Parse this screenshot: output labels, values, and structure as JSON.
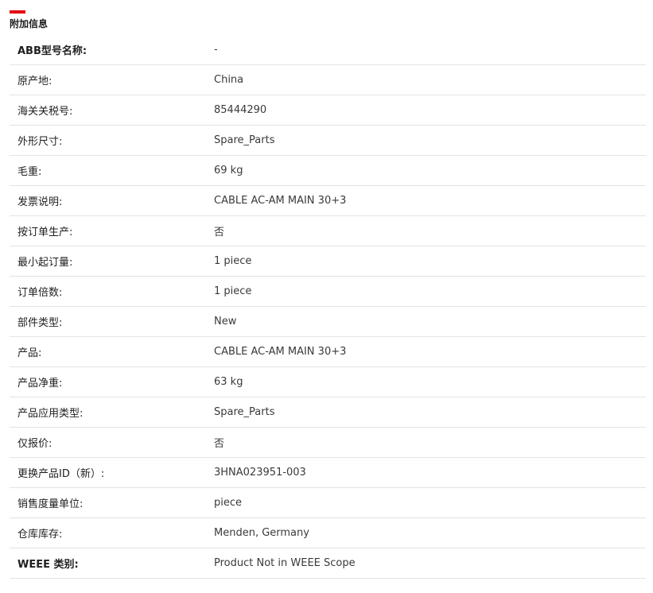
{
  "section": {
    "title": "附加信息",
    "accent_color": "#e60012"
  },
  "rows": [
    {
      "label": "ABB型号名称:",
      "value": "-"
    },
    {
      "label": "原产地:",
      "value": "China"
    },
    {
      "label": "海关关税号:",
      "value": "85444290"
    },
    {
      "label": "外形尺寸:",
      "value": "Spare_Parts"
    },
    {
      "label": "毛重:",
      "value": "69 kg"
    },
    {
      "label": "发票说明:",
      "value": "CABLE AC-AM MAIN 30+3"
    },
    {
      "label": "按订单生产:",
      "value": "否"
    },
    {
      "label": "最小起订量:",
      "value": "1 piece"
    },
    {
      "label": "订单倍数:",
      "value": "1 piece"
    },
    {
      "label": "部件类型:",
      "value": "New"
    },
    {
      "label": "产品:",
      "value": "CABLE AC-AM MAIN 30+3"
    },
    {
      "label": "产品净重:",
      "value": "63 kg"
    },
    {
      "label": "产品应用类型:",
      "value": "Spare_Parts"
    },
    {
      "label": "仅报价:",
      "value": "否"
    },
    {
      "label": "更换产品ID（新）:",
      "value": "3HNA023951-003"
    },
    {
      "label": "销售度量单位:",
      "value": "piece"
    },
    {
      "label": "仓库库存:",
      "value": "Menden, Germany"
    },
    {
      "label": "WEEE 类别:",
      "value": "Product Not in WEEE Scope"
    }
  ]
}
